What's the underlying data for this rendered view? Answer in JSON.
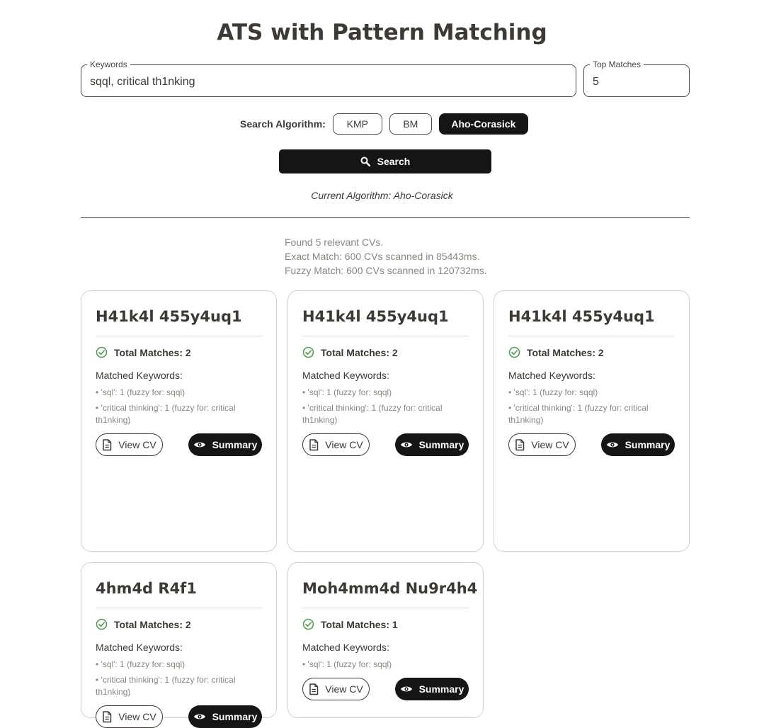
{
  "page": {
    "title": "ATS with Pattern Matching"
  },
  "keywords_field": {
    "label": "Keywords",
    "value": "sqql, critical th1nking"
  },
  "top_matches_field": {
    "label": "Top Matches",
    "value": "5"
  },
  "algorithm": {
    "label": "Search Algorithm:",
    "options": [
      "KMP",
      "BM",
      "Aho-Corasick"
    ],
    "selected": "Aho-Corasick",
    "current_text": "Current Algorithm: Aho-Corasick"
  },
  "search_button": {
    "label": "Search",
    "icon": "search-icon"
  },
  "results": {
    "found": "Found 5 relevant CVs.",
    "exact": "Exact Match: 600 CVs scanned in 85443ms.",
    "fuzzy": "Fuzzy Match: 600 CVs scanned in 120732ms."
  },
  "card_labels": {
    "matched_keywords": "Matched Keywords:",
    "view_cv": "View CV",
    "summary": "Summary"
  },
  "cards": [
    {
      "name": "H41k4l 455y4uq1",
      "total": "Total Matches: 2",
      "keywords": [
        "• 'sql': 1 (fuzzy for: sqql)",
        "• 'critical thinking': 1 (fuzzy for: critical th1nking)"
      ]
    },
    {
      "name": "H41k4l 455y4uq1",
      "total": "Total Matches: 2",
      "keywords": [
        "• 'sql': 1 (fuzzy for: sqql)",
        "• 'critical thinking': 1 (fuzzy for: critical th1nking)"
      ]
    },
    {
      "name": "H41k4l 455y4uq1",
      "total": "Total Matches: 2",
      "keywords": [
        "• 'sql': 1 (fuzzy for: sqql)",
        "• 'critical thinking': 1 (fuzzy for: critical th1nking)"
      ]
    },
    {
      "name": "4hm4d R4f1",
      "total": "Total Matches: 2",
      "keywords": [
        "• 'sql': 1 (fuzzy for: sqql)",
        "• 'critical thinking': 1 (fuzzy for: critical th1nking)"
      ]
    },
    {
      "name": "Moh4mm4d Nu9r4h4",
      "total": "Total Matches: 1",
      "keywords": [
        "• 'sql': 1 (fuzzy for: sqql)"
      ]
    }
  ],
  "colors": {
    "primary": "#151515",
    "text": "#3d3a35",
    "muted": "#8a8680",
    "success": "#5a9a5a"
  }
}
